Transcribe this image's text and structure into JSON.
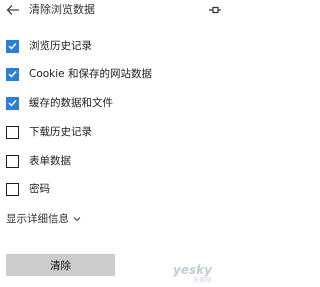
{
  "header": {
    "title": "清除浏览数据",
    "back_icon": "back-arrow-icon",
    "pin_icon": "pin-icon"
  },
  "options": [
    {
      "label": "浏览历史记录",
      "checked": true
    },
    {
      "label": "Cookie 和保存的网站数据",
      "checked": true
    },
    {
      "label": "缓存的数据和文件",
      "checked": true
    },
    {
      "label": "下载历史记录",
      "checked": false
    },
    {
      "label": "表单数据",
      "checked": false
    },
    {
      "label": "密码",
      "checked": false
    }
  ],
  "details_toggle": {
    "label": "显示详细信息",
    "icon": "chevron-down-icon"
  },
  "clear_button": {
    "label": "清除"
  },
  "watermark": {
    "text": "yesky",
    "subtext": "天极网"
  },
  "colors": {
    "accent": "#2b7fd6",
    "button_bg": "#cccccc",
    "text": "#1f1f1f"
  }
}
